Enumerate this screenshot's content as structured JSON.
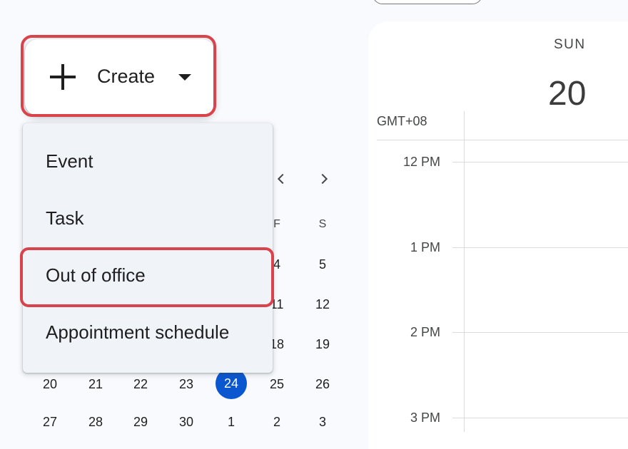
{
  "create": {
    "label": "Create"
  },
  "menu": {
    "items": [
      "Event",
      "Task",
      "Out of office",
      "Appointment schedule"
    ]
  },
  "mini_calendar": {
    "visible_day_headers": [
      "F",
      "S"
    ],
    "visible_dates": {
      "row1": [
        "4",
        "5"
      ],
      "row2": [
        "11",
        "12"
      ],
      "row3": [
        "18",
        "19"
      ],
      "row4": [
        "20",
        "21",
        "22",
        "23",
        "24",
        "25",
        "26"
      ],
      "row5": [
        "27",
        "28",
        "29",
        "30",
        "1",
        "2",
        "3"
      ]
    },
    "today": "24"
  },
  "day_view": {
    "day_name": "SUN",
    "day_number": "20",
    "timezone": "GMT+08",
    "hours": [
      "12 PM",
      "1 PM",
      "2 PM",
      "3 PM"
    ]
  },
  "colors": {
    "accent": "#0b57d0",
    "highlight": "#d9434c"
  },
  "icons": [
    "plus-icon",
    "caret-down-icon",
    "chevron-left-icon",
    "chevron-right-icon"
  ]
}
